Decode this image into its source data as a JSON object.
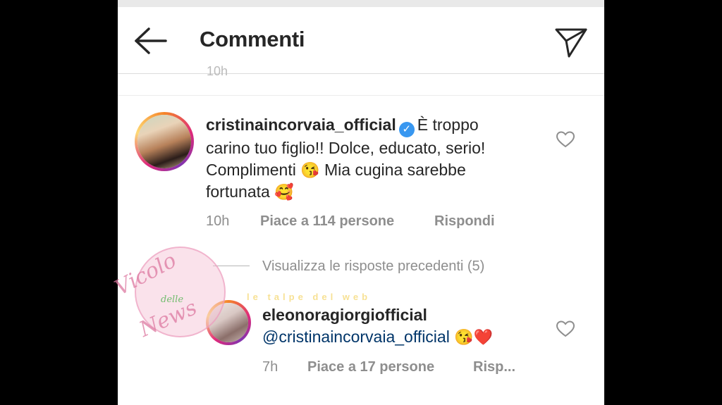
{
  "header": {
    "title": "Commenti",
    "back_icon": "arrow-left-icon",
    "share_icon": "paper-plane-icon"
  },
  "ghost_time": "10h",
  "comments": [
    {
      "username": "cristinaincorvaia_official",
      "verified": true,
      "text_line1": "È troppo",
      "text_line2": "carino tuo figlio!! Dolce, educato, serio!",
      "text_line3": "Complimenti",
      "emoji_kiss": "😘",
      "text_line3b": "Mia cugina sarebbe",
      "text_line4": "fortunata",
      "emoji_love": "🥰",
      "time": "10h",
      "likes": "Piace a 114 persone",
      "reply": "Rispondi"
    }
  ],
  "view_replies": "Visualizza le risposte precedenti (5)",
  "reply": {
    "username": "eleonoragiorgiofficial",
    "mention": "@cristinaincorvaia_official",
    "emoji_kiss": "😘",
    "emoji_heart": "❤️",
    "time": "7h",
    "likes": "Piace a 17 persone",
    "reply": "Risp..."
  },
  "watermark": {
    "line1": "Vicolo",
    "line2": "delle",
    "line3": "News",
    "bubble": "le talpe del web"
  },
  "colors": {
    "verified": "#3897f0",
    "mention": "#003569",
    "meta": "#8e8e8e"
  }
}
